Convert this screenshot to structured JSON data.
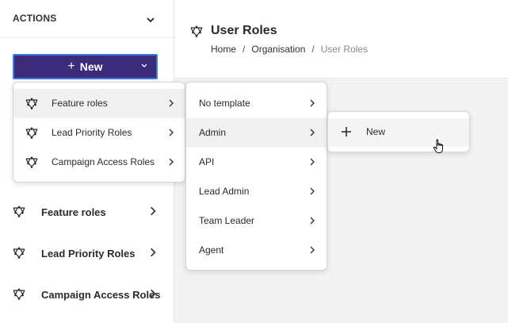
{
  "sidebar": {
    "actions_title": "ACTIONS",
    "new_button": {
      "plus": "+",
      "label": "New"
    },
    "items": [
      {
        "label": "Feature roles"
      },
      {
        "label": "Lead Priority Roles"
      },
      {
        "label": "Campaign Access Roles"
      }
    ]
  },
  "header": {
    "title": "User Roles",
    "breadcrumb": {
      "home": "Home",
      "sep": "/",
      "org": "Organisation",
      "current": "User Roles"
    }
  },
  "dropdown_level1": [
    {
      "label": "Feature roles"
    },
    {
      "label": "Lead Priority Roles"
    },
    {
      "label": "Campaign Access Roles"
    }
  ],
  "dropdown_level2": [
    {
      "label": "No template"
    },
    {
      "label": "Admin"
    },
    {
      "label": "API"
    },
    {
      "label": "Lead Admin"
    },
    {
      "label": "Team Leader"
    },
    {
      "label": "Agent"
    }
  ],
  "dropdown_level3": {
    "plus": "+",
    "label": "New"
  },
  "colors": {
    "primary": "#3c2a7a",
    "focus_ring": "#3f7bd6",
    "content_bg": "#f3f3f3"
  }
}
